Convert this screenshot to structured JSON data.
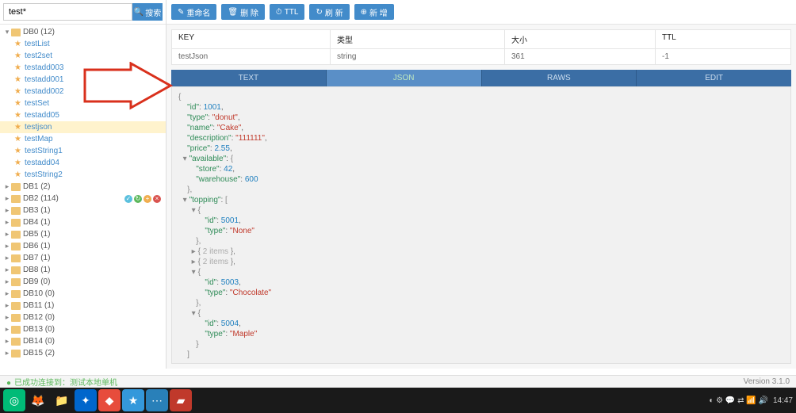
{
  "search": {
    "value": "test*",
    "btn": "搜索"
  },
  "tree": {
    "db0": {
      "label": "DB0 (12)",
      "expanded": true,
      "keys": [
        "testList",
        "test2set",
        "testadd003",
        "testadd001",
        "testadd002",
        "testSet",
        "testadd05",
        "testjson",
        "testMap",
        "testString1",
        "testadd04",
        "testString2"
      ],
      "selected": "testjson"
    },
    "dbs": [
      {
        "label": "DB1 (2)"
      },
      {
        "label": "DB2 (114)",
        "actions": true
      },
      {
        "label": "DB3 (1)"
      },
      {
        "label": "DB4 (1)"
      },
      {
        "label": "DB5 (1)"
      },
      {
        "label": "DB6 (1)"
      },
      {
        "label": "DB7 (1)"
      },
      {
        "label": "DB8 (1)"
      },
      {
        "label": "DB9 (0)"
      },
      {
        "label": "DB10 (0)"
      },
      {
        "label": "DB11 (1)"
      },
      {
        "label": "DB12 (0)"
      },
      {
        "label": "DB13 (0)"
      },
      {
        "label": "DB14 (0)"
      },
      {
        "label": "DB15 (2)"
      }
    ]
  },
  "actions": {
    "rename": "重命名",
    "delete": "删 除",
    "ttl": "TTL",
    "refresh": "刷 新",
    "new": "新 增"
  },
  "kv": {
    "headers": {
      "key": "KEY",
      "type": "类型",
      "size": "大小",
      "ttl": "TTL"
    },
    "row": {
      "key": "testJson",
      "type": "string",
      "size": "361",
      "ttl": "-1"
    }
  },
  "tabs": {
    "text": "TEXT",
    "json": "JSON",
    "raws": "RAWS",
    "edit": "EDIT"
  },
  "json_content": {
    "id": 1001,
    "type": "donut",
    "name": "Cake",
    "description": "111111",
    "price": 2.55,
    "available": {
      "store": 42,
      "warehouse": 600
    },
    "topping_collapsed": "2 items",
    "toppings": [
      {
        "id": 5001,
        "type": "None"
      },
      {
        "id": 5003,
        "type": "Chocolate"
      },
      {
        "id": 5004,
        "type": "Maple"
      }
    ]
  },
  "status": {
    "text": "已成功连接到：测试本地单机",
    "version": "Version 3.1.0"
  },
  "taskbar": {
    "time": "14:47"
  }
}
